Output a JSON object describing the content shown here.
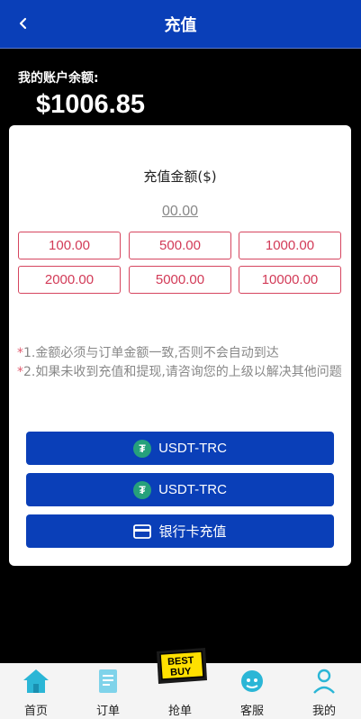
{
  "header": {
    "title": "充值"
  },
  "balance": {
    "label": "我的账户余额:",
    "value": "$1006.85"
  },
  "recharge": {
    "amount_title": "充值金额($)",
    "amount_value": "00.00",
    "presets": [
      "100.00",
      "500.00",
      "1000.00",
      "2000.00",
      "5000.00",
      "10000.00"
    ]
  },
  "notes": {
    "star": "*",
    "line1": "1.金额必须与订单金额一致,否则不会自动到达",
    "line2": "2.如果未收到充值和提现,请咨询您的上级以解决其他问题"
  },
  "payment_buttons": [
    {
      "label": "USDT-TRC",
      "icon": "tether-icon"
    },
    {
      "label": "USDT-TRC",
      "icon": "tether-icon"
    },
    {
      "label": "银行卡充值",
      "icon": "card-icon"
    }
  ],
  "tabbar": {
    "home": "首页",
    "orders": "订单",
    "grab": "抢单",
    "service": "客服",
    "mine": "我的",
    "logo_text": "BEST BUY"
  },
  "colors": {
    "primary": "#0a3fb8",
    "chip_border": "#d6455f",
    "tether": "#26a17b",
    "tab_icon": "#2bb6d6"
  }
}
